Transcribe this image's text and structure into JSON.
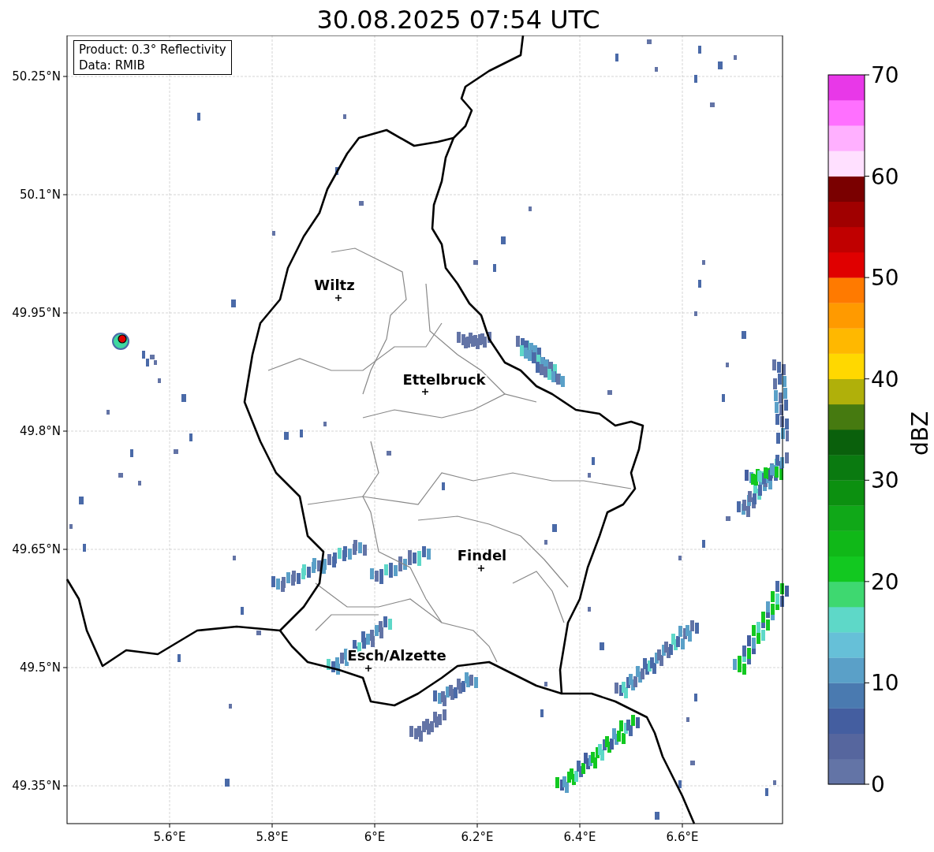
{
  "title": "30.08.2025 07:54 UTC",
  "info_box": {
    "lines": [
      "Product: 0.3° Reflectivity",
      "Data: RMIB"
    ]
  },
  "map": {
    "xticks": [
      "5.6°E",
      "5.8°E",
      "6°E",
      "6.2°E",
      "6.4°E",
      "6.6°E"
    ],
    "yticks": [
      "50.25°N",
      "50.1°N",
      "49.95°N",
      "49.8°N",
      "49.65°N",
      "49.5°N",
      "49.35°N"
    ],
    "cities": [
      {
        "name": "Wiltz"
      },
      {
        "name": "Ettelbruck"
      },
      {
        "name": "Findel"
      },
      {
        "name": "Esch/Alzette"
      }
    ]
  },
  "colorbar": {
    "label": "dBZ",
    "ticks": [
      "70",
      "60",
      "50",
      "40",
      "30",
      "20",
      "10",
      "0"
    ],
    "bands": [
      {
        "color": "#6374a6"
      },
      {
        "color": "#56669e"
      },
      {
        "color": "#445ea0"
      },
      {
        "color": "#4a7ab0"
      },
      {
        "color": "#5aa0c8"
      },
      {
        "color": "#66c0d8"
      },
      {
        "color": "#5ed8c8"
      },
      {
        "color": "#3ed870"
      },
      {
        "color": "#12c820"
      },
      {
        "color": "#10b818"
      },
      {
        "color": "#10a818"
      },
      {
        "color": "#0c9010"
      },
      {
        "color": "#0a7a10"
      },
      {
        "color": "#0a600c"
      },
      {
        "color": "#467a10"
      },
      {
        "color": "#b0b00a"
      },
      {
        "color": "#ffd800"
      },
      {
        "color": "#ffb800"
      },
      {
        "color": "#ff9a00"
      },
      {
        "color": "#ff7a00"
      },
      {
        "color": "#e00000"
      },
      {
        "color": "#c00000"
      },
      {
        "color": "#a00000"
      },
      {
        "color": "#7a0000"
      },
      {
        "color": "#ffe0ff"
      },
      {
        "color": "#ffb0ff"
      },
      {
        "color": "#ff70ff"
      },
      {
        "color": "#e838e8"
      }
    ]
  }
}
